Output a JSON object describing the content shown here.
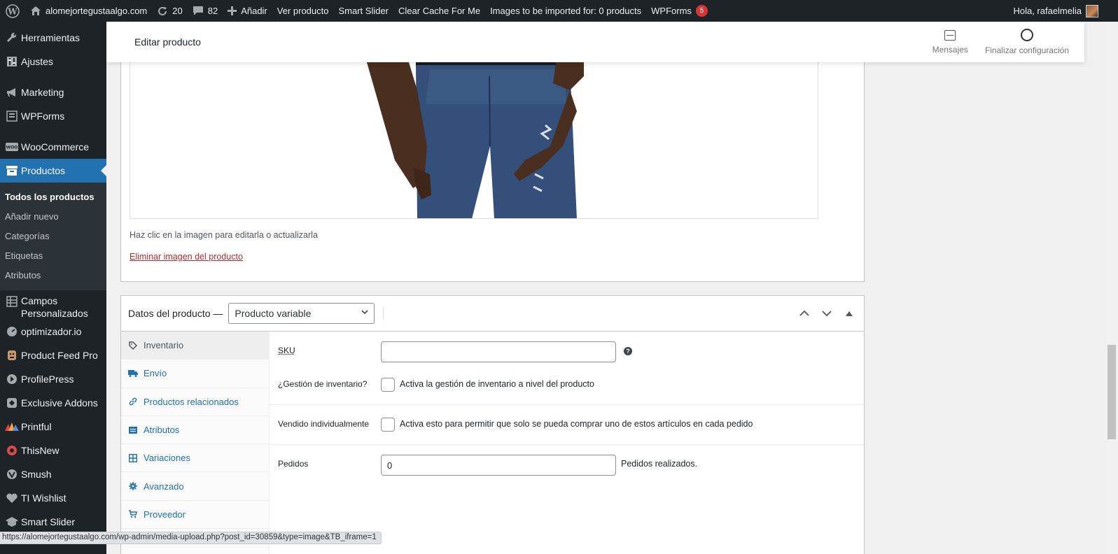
{
  "admin_bar": {
    "site_name": "alomejortegustaalgo.com",
    "updates_count": "20",
    "comments_count": "82",
    "new_label": "Añadir",
    "view_product": "Ver producto",
    "smart_slider": "Smart Slider",
    "clear_cache": "Clear Cache For Me",
    "images_import": "Images to be imported for: 0 products",
    "wpforms": "WPForms",
    "wpforms_badge": "5",
    "greeting": "Hola, rafaelmelia"
  },
  "sidebar": {
    "items_top": [
      {
        "label": "Herramientas",
        "icon": "wrench-icon"
      },
      {
        "label": "Ajustes",
        "icon": "settings-icon"
      }
    ],
    "items_mid": [
      {
        "label": "Marketing",
        "icon": "megaphone-icon"
      },
      {
        "label": "WPForms",
        "icon": "form-icon"
      }
    ],
    "woocommerce": "WooCommerce",
    "productos": "Productos",
    "submenu": [
      "Todos los productos",
      "Añadir nuevo",
      "Categorías",
      "Etiquetas",
      "Atributos"
    ],
    "campos_line1": "Campos",
    "campos_line2": "Personalizados",
    "items_bottom": [
      {
        "label": "optimizador.io",
        "icon": "gauge-icon"
      },
      {
        "label": "Product Feed Pro",
        "icon": "feed-icon"
      },
      {
        "label": "ProfilePress",
        "icon": "profile-icon"
      },
      {
        "label": "Exclusive Addons",
        "icon": "addons-icon"
      },
      {
        "label": "Printful",
        "icon": "printful-icon"
      },
      {
        "label": "ThisNew",
        "icon": "thisnew-icon"
      },
      {
        "label": "Smush",
        "icon": "smush-icon"
      },
      {
        "label": "TI Wishlist",
        "icon": "heart-icon"
      },
      {
        "label": "Smart Slider",
        "icon": "slider-icon"
      }
    ]
  },
  "header": {
    "title": "Editar producto",
    "messages": "Mensajes",
    "finish_setup": "Finalizar configuración"
  },
  "image_box": {
    "hint": "Haz clic en la imagen para editarla o actualizarla",
    "remove_link": "Eliminar imagen del producto"
  },
  "product_data": {
    "title": "Datos del producto —",
    "type_selected": "Producto variable",
    "tabs": [
      "Inventario",
      "Envío",
      "Productos relacionados",
      "Atributos",
      "Variaciones",
      "Avanzado",
      "Proveedor"
    ],
    "sku_label": "SKU",
    "sku_value": "",
    "stock_mgmt_label": "¿Gestión de inventario?",
    "stock_mgmt_text": "Activa la gestión de inventario a nivel del producto",
    "sold_ind_label": "Vendido individualmente",
    "sold_ind_text": "Activa esto para permitir que solo se pueda comprar uno de estos artículos en cada pedido",
    "orders_label": "Pedidos",
    "orders_value": "0",
    "orders_suffix": "Pedidos realizados."
  },
  "status_url": "https://alomejortegustaalgo.com/wp-admin/media-upload.php?post_id=30859&type=image&TB_iframe=1"
}
